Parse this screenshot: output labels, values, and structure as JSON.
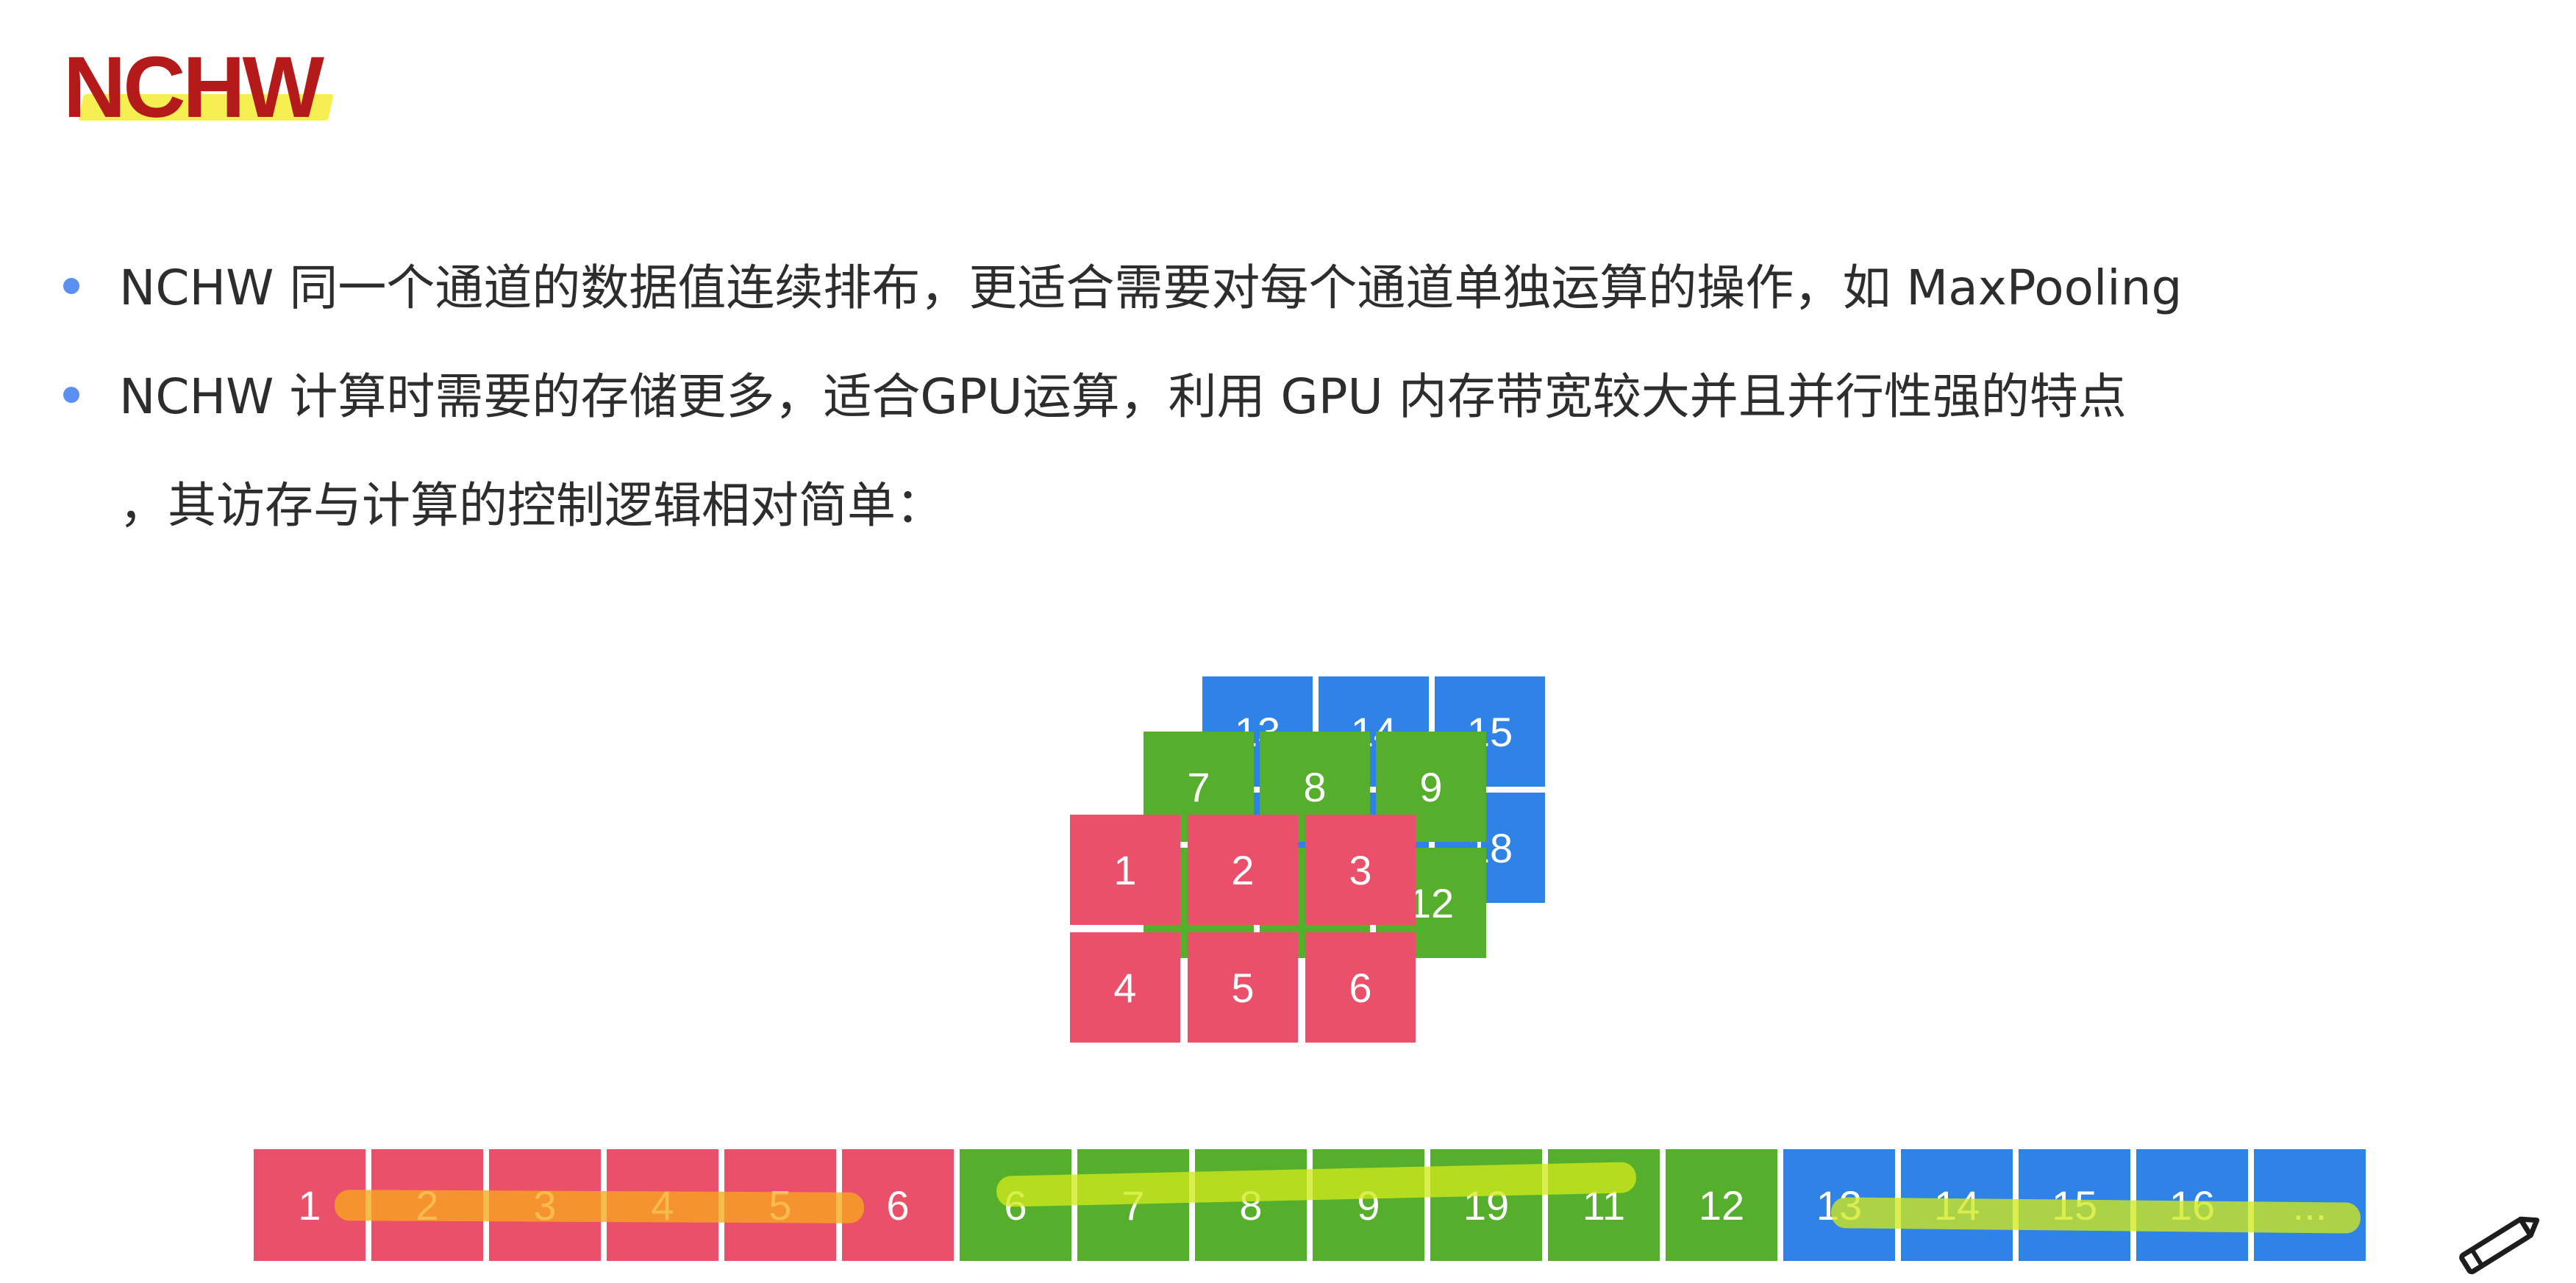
{
  "slide": {
    "title": "NCHW",
    "bullets": [
      {
        "line1": "NCHW 同一个通道的数据值连续排布，更适合需要对每个通道单独运算的操作，如 MaxPooling",
        "line2": ""
      },
      {
        "line1": "NCHW 计算时需要的存储更多，适合GPU运算，利用 GPU 内存带宽较大并且并行性强的特点",
        "line2": "，其访存与计算的控制逻辑相对简单："
      }
    ]
  },
  "tensor_diagram": {
    "colors": {
      "channel_1": "#ea5069",
      "channel_2": "#56af2c",
      "channel_3": "#2f82e6"
    },
    "blue_layer": [
      "13",
      "14",
      "15",
      "",
      "",
      "18"
    ],
    "green_layer": [
      "7",
      "8",
      "9",
      "",
      "",
      "12"
    ],
    "red_layer": [
      "1",
      "2",
      "3",
      "4",
      "5",
      "6"
    ]
  },
  "memory_strip": {
    "cells": [
      {
        "label": "1",
        "color": "red"
      },
      {
        "label": "2",
        "color": "red"
      },
      {
        "label": "3",
        "color": "red"
      },
      {
        "label": "4",
        "color": "red"
      },
      {
        "label": "5",
        "color": "red"
      },
      {
        "label": "6",
        "color": "red"
      },
      {
        "label": "6",
        "color": "green"
      },
      {
        "label": "7",
        "color": "green"
      },
      {
        "label": "8",
        "color": "green"
      },
      {
        "label": "9",
        "color": "green"
      },
      {
        "label": "19",
        "color": "green"
      },
      {
        "label": "11",
        "color": "green"
      },
      {
        "label": "12",
        "color": "green"
      },
      {
        "label": "13",
        "color": "blue"
      },
      {
        "label": "14",
        "color": "blue"
      },
      {
        "label": "15",
        "color": "blue"
      },
      {
        "label": "16",
        "color": "blue"
      },
      {
        "label": "...",
        "color": "blue"
      }
    ]
  }
}
